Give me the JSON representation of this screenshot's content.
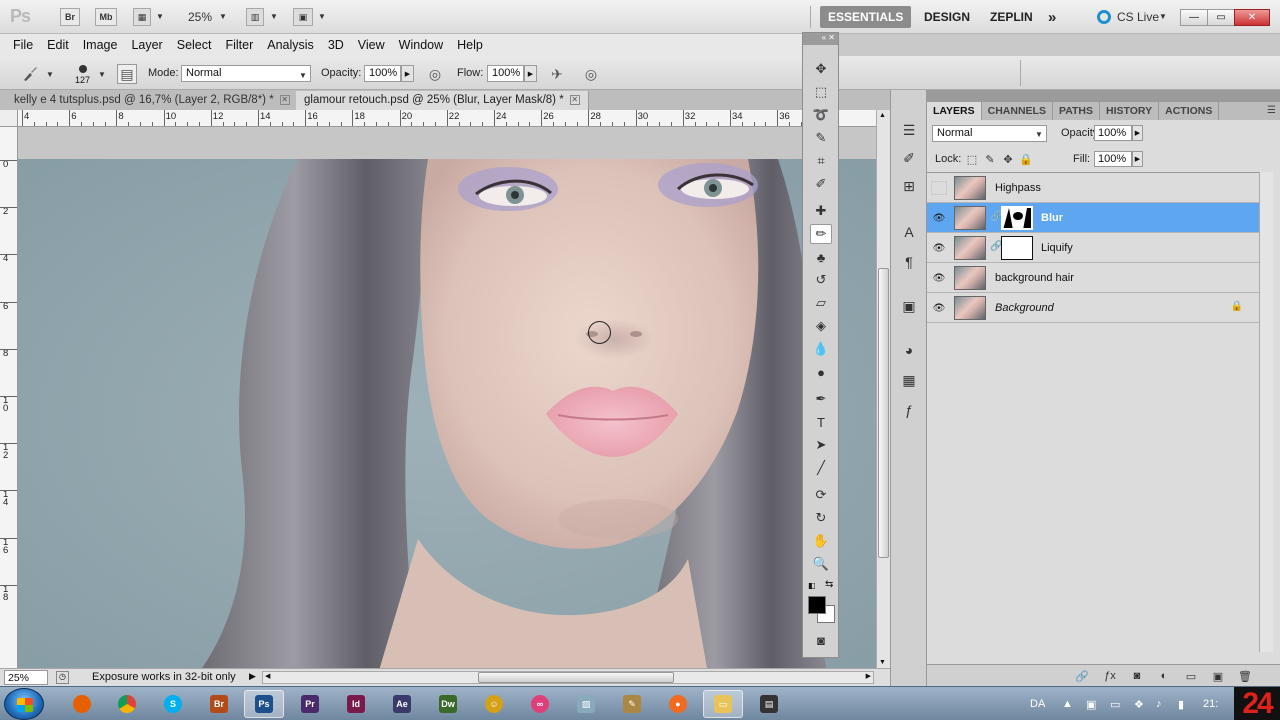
{
  "app_bar": {
    "logo": "Ps",
    "bridge_button": "Br",
    "minibridge_button": "Mb",
    "zoom_level": "25%",
    "workspaces": [
      "ESSENTIALS",
      "DESIGN",
      "ZEPLIN"
    ],
    "more_workspaces": "»",
    "cs_live": "CS Live"
  },
  "menu": {
    "items": [
      "File",
      "Edit",
      "Image",
      "Layer",
      "Select",
      "Filter",
      "Analysis",
      "3D",
      "View",
      "Window",
      "Help"
    ]
  },
  "options": {
    "brush_size": "127",
    "mode_label": "Mode:",
    "mode_value": "Normal",
    "opacity_label": "Opacity:",
    "opacity_value": "100%",
    "flow_label": "Flow:",
    "flow_value": "100%"
  },
  "documents": {
    "tabs": [
      {
        "title": "kelly e 4 tutsplus.psd @ 16,7% (Layer 2, RGB/8*) *",
        "active": false
      },
      {
        "title": "glamour retouch.psd @ 25% (Blur, Layer Mask/8) *",
        "active": true
      }
    ]
  },
  "ruler": {
    "h_labels": [
      "4",
      "6",
      "8",
      "10",
      "12",
      "14",
      "16",
      "18",
      "20",
      "22",
      "24",
      "26",
      "28",
      "30",
      "32",
      "34",
      "36"
    ],
    "v_labels": [
      "0",
      "2",
      "4",
      "6",
      "8",
      "10",
      "12",
      "14",
      "16",
      "18"
    ]
  },
  "status": {
    "zoom": "25%",
    "message": "Exposure works in 32-bit only"
  },
  "panels": {
    "tabs": [
      "LAYERS",
      "CHANNELS",
      "PATHS",
      "HISTORY",
      "ACTIONS"
    ],
    "active_tab": "LAYERS",
    "blend_mode": "Normal",
    "opacity_label": "Opacity:",
    "opacity_value": "100%",
    "lock_label": "Lock:",
    "fill_label": "Fill:",
    "fill_value": "100%"
  },
  "layers": [
    {
      "name": "Highpass",
      "visible": false,
      "selected": false,
      "has_mask": false,
      "locked": false,
      "italic": false
    },
    {
      "name": "Blur",
      "visible": true,
      "selected": true,
      "has_mask": true,
      "locked": false,
      "italic": false
    },
    {
      "name": "Liquify",
      "visible": true,
      "selected": false,
      "has_mask": true,
      "locked": false,
      "italic": false
    },
    {
      "name": "background hair",
      "visible": true,
      "selected": false,
      "has_mask": false,
      "locked": false,
      "italic": false
    },
    {
      "name": "Background",
      "visible": true,
      "selected": false,
      "has_mask": false,
      "locked": true,
      "italic": true
    }
  ],
  "taskbar": {
    "language": "DA",
    "clock": "21:"
  },
  "overlay_badge": "24",
  "colors": {
    "selection_blue": "#5ea6f0",
    "foreground_color": "#000000",
    "background_color": "#ffffff"
  }
}
